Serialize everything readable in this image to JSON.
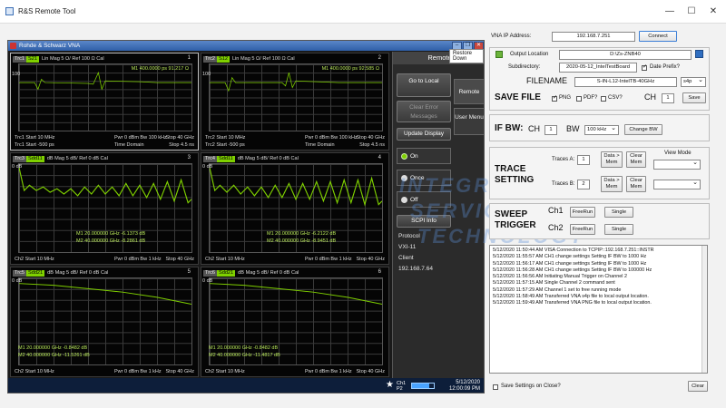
{
  "app": {
    "title": "R&S Remote Tool",
    "controls": [
      "—",
      "☐",
      "✕"
    ]
  },
  "vna": {
    "title": "Rohde & Schwarz VNA",
    "tooltip": "Restore Down",
    "panels": [
      {
        "trace": "Trc1",
        "param": "S21",
        "fmt": "Lin Mag 5 Ω/ Ref 100 Ω  Cal",
        "num": "1",
        "ref": "100",
        "marker": "M1  400.0000 ps  91.217 Ω",
        "footer_l": "Trc1  Start  10 MHz",
        "footer_m": "Pwr  0 dBm  Bw  100 kHz",
        "footer_r": "Stop  40 GHz",
        "footer2_l": "Trc1  Start  -500 ps",
        "footer2_m": "Time  Domain",
        "footer2_r": "Stop  4.5 ns"
      },
      {
        "trace": "Trc2",
        "param": "S12",
        "fmt": "Lin Mag 5 Ω/ Ref 100 Ω  Cal",
        "num": "2",
        "ref": "100",
        "marker": "M1  400.0000 ps  92.585 Ω",
        "footer_l": "Trc2  Start  10 MHz",
        "footer_m": "Pwr  0 dBm  Bw  100 kHz",
        "footer_r": "Stop  40 GHz",
        "footer2_l": "Trc2  Start  -500 ps",
        "footer2_m": "Time  Domain",
        "footer2_r": "Stop  4.5 ns"
      },
      {
        "trace": "Trc3",
        "param": "Sdd11",
        "fmt": "dB Mag 5 dB/ Ref 0 dB  Cal",
        "num": "3",
        "ref": "0 dB",
        "marker1": "M1  20.000000 GHz  -6.1373 dB",
        "marker2": "M2  40.000000 GHz  -8.2861 dB",
        "footer_l": "Ch2  Start  10 MHz",
        "footer_m": "Pwr  0 dBm  Bw  1 kHz",
        "footer_r": "Stop  40 GHz"
      },
      {
        "trace": "Trc4",
        "param": "Sdd11",
        "fmt": "dB Mag 5 dB/ Ref 0 dB  Cal",
        "num": "4",
        "ref": "0 dB",
        "marker1": "M1  20.000000 GHz  -6.2122 dB",
        "marker2": "M2  40.000000 GHz  -8.9451 dB",
        "footer_l": "Ch2  Start  10 MHz",
        "footer_m": "Pwr  0 dBm  Bw  1 kHz",
        "footer_r": "Stop  40 GHz"
      },
      {
        "trace": "Trc5",
        "param": "Sdd21",
        "fmt": "dB Mag 5 dB/ Ref 0 dB  Cal",
        "num": "5",
        "ref": "0 dB",
        "marker1": "M1  20.000000 GHz  -0.8482 dB",
        "marker2": "M2  40.000000 GHz  -11.5261 dB",
        "footer_l": "Ch2  Start  10 MHz",
        "footer_m": "Pwr  0 dBm  Bw  1 kHz",
        "footer_r": "Stop  40 GHz"
      },
      {
        "trace": "Trc6",
        "param": "Sdd21",
        "fmt": "dB Mag 5 dB/ Ref 0 dB  Cal",
        "num": "6",
        "ref": "0 dB",
        "marker1": "M1  20.000000 GHz  -0.8482 dB",
        "marker2": "M2  40.000000 GHz  -11.4817 dB",
        "footer_l": "Ch2  Start  10 MHz",
        "footer_m": "Pwr  0 dBm  Bw  1 kHz",
        "footer_r": "Stop  40 GHz"
      }
    ],
    "remote": {
      "header": "Remote",
      "go_local": "Go to Local",
      "clear_errors": "Clear Error Messages",
      "update_display": "Update Display",
      "on": "On",
      "once": "Once",
      "off": "Off",
      "scpi_info": "SCPI Info",
      "tab_remote": "Remote",
      "tab_user_menu": "User Menu",
      "protocol_label": "Protocol",
      "protocol_value": "VXI-11",
      "client_label": "Client",
      "client_value": "192.168.7.64"
    },
    "status": {
      "ch": "Ch1",
      "port": "P2",
      "date": "5/12/2020",
      "time": "12:00:09 PM"
    }
  },
  "watermark": [
    "INTEGRATED",
    "SERVICE",
    "TECHNOLOGY"
  ],
  "controls": {
    "vna_ip_label": "VNA IP Address:",
    "vna_ip_value": "192.168.7.251",
    "connect": "Connect",
    "output_location_label": "Output Location",
    "output_location_value": "D:\\Zs-ZNB40",
    "subdirectory_label": "Subdirectory:",
    "subdirectory_value": "2020-05-12_IntelTestBoard",
    "date_prefix": "Date Prefix?",
    "date_prefix_checked": true,
    "filename_label": "FILENAME",
    "filename_value": "S-IN-L12-IntelTB-40GHz",
    "filetype_value": "s4p",
    "save_file_label": "SAVE FILE",
    "png": "PNG",
    "pdf": "PDF?",
    "csv": "CSV?",
    "ch_label": "CH",
    "ch_value": "1",
    "save": "Save",
    "ifbw_label": "IF BW:",
    "ifbw_ch_label": "CH",
    "ifbw_ch_value": "1",
    "ifbw_bw_label": "BW",
    "ifbw_bw_value": "100 kHz",
    "change_bw": "Change BW",
    "trace_setting_label": "TRACE SETTING",
    "traces_a_label": "Traces A:",
    "traces_a_value": "1",
    "traces_b_label": "Traces B:",
    "traces_b_value": "2",
    "date_mem": "Data > Mem",
    "clear_mem": "Clear Mem",
    "view_mode_label": "View Mode",
    "sweep_trigger_label": "SWEEP TRIGGER",
    "ch1_label": "Ch1",
    "ch2_label": "Ch2",
    "free_run": "FreeRun",
    "single": "Single",
    "save_settings_label": "Save Settings on Close?",
    "clear": "Clear"
  },
  "log": [
    "5/12/2020 11:50:44 AM VISA Connection to TCPIP::192.168.7.251::INSTR",
    "5/12/2020 11:55:57 AM CH1 change settings Setting IF BW to 1000 Hz",
    "5/12/2020 11:56:17 AM CH1 change settings Setting IF BW to 1000 Hz",
    "5/12/2020 11:56:28 AM CH1 change settings Setting IF BW to 100000 Hz",
    "5/12/2020 11:56:56 AM Initiating Manual Trigger on Channel 2",
    "5/12/2020 11:57:15 AM Single Channel 2 command sent",
    "5/12/2020 11:57:29 AM Channel 1 set to free running mode",
    "5/12/2020 11:58:49 AM Transferred VNA s4p file to local output location.",
    "5/12/2020 11:59:49 AM Transferred VNA PNG file to local output location."
  ],
  "colors": {
    "trace": "#7fd000",
    "window_blue": "#2f5fa8",
    "watermark": "#5c8fd6"
  }
}
